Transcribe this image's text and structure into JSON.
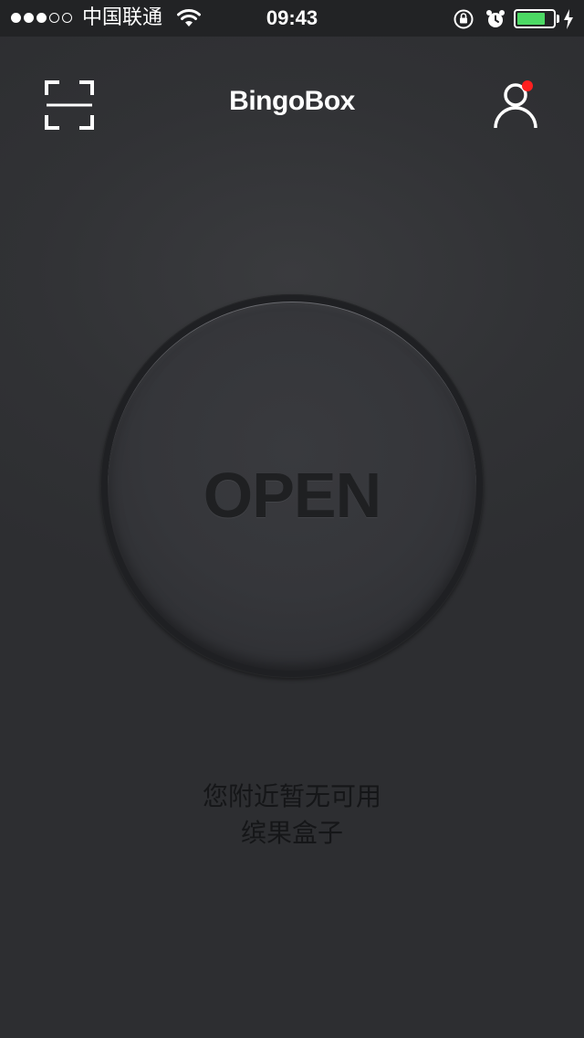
{
  "status_bar": {
    "carrier": "中国联通",
    "time": "09:43",
    "signal_bars_filled": 3,
    "signal_bars_total": 5,
    "battery_level": 0.8,
    "battery_color": "#4cd964",
    "icons": [
      "wifi-icon",
      "rotation-lock-icon",
      "alarm-icon",
      "battery-icon",
      "charging-icon"
    ]
  },
  "header": {
    "scan_icon": "scan-icon",
    "brand": "BingoBox",
    "profile_icon": "profile-icon",
    "notification_color": "#ff1f1f"
  },
  "main": {
    "open_label": "OPEN",
    "message_line1": "您附近暂无可用",
    "message_line2": "缤果盒子"
  }
}
